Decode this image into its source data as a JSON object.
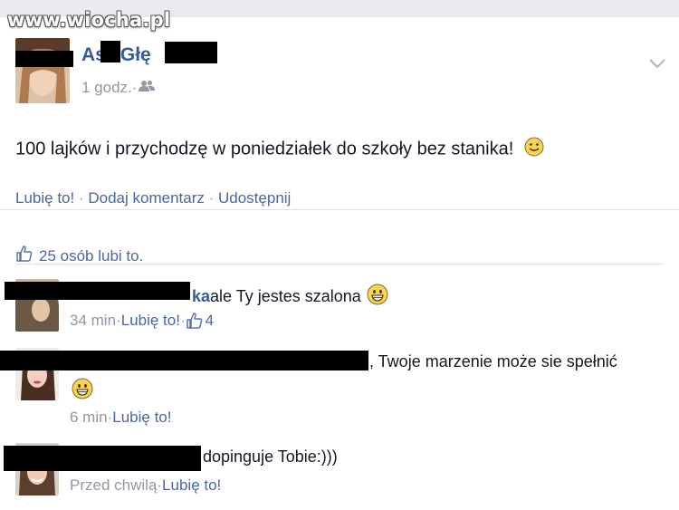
{
  "watermark": "www.wiocha.pl",
  "post": {
    "author_visible_start": "As",
    "author_visible_mid": "Głę",
    "time": "1 godz.",
    "separator": " · ",
    "text": "100 lajków i przychodzę w poniedziałek do szkoły bez stanika!",
    "text_emoji": "smiley-icon",
    "actions": {
      "like": "Lubię to!",
      "comment": "Dodaj komentarz",
      "share": "Udostępnij"
    }
  },
  "likes_summary": "25 osób lubi to.",
  "comments": [
    {
      "name_tail": "ka",
      "text": " ale Ty jestes szalona",
      "emoji": "grin-icon",
      "time": "34 min",
      "like": "Lubię to!",
      "like_count": "4"
    },
    {
      "text": ", Twoje marzenie może sie spełnić",
      "emoji": "grin-icon",
      "time": "6 min",
      "like": "Lubię to!"
    },
    {
      "text": "dopinguje Tobie:)))",
      "time": "Przed chwilą",
      "like": "Lubię to!"
    }
  ],
  "colors": {
    "link": "#4b67a1",
    "meta": "#9197a3",
    "text": "#141823",
    "redaction": "#000000"
  }
}
